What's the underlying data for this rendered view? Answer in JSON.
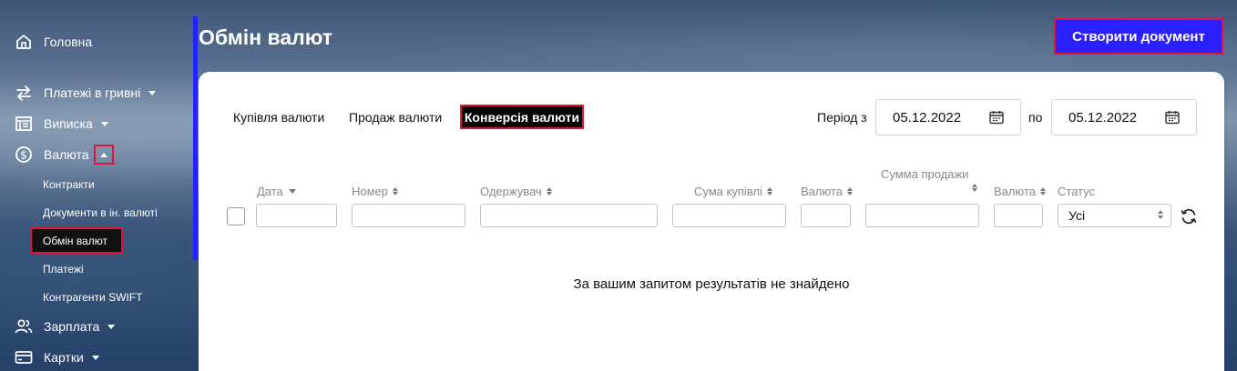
{
  "sidebar": {
    "items": [
      {
        "label": "Головна",
        "icon": "home-icon"
      },
      {
        "label": "Платежі в гривні",
        "icon": "transfer-icon"
      },
      {
        "label": "Виписка",
        "icon": "statement-icon"
      },
      {
        "label": "Валюта",
        "icon": "currency-icon"
      },
      {
        "label": "Зарплата",
        "icon": "users-icon"
      },
      {
        "label": "Картки",
        "icon": "card-icon"
      }
    ],
    "currency_sub": [
      "Контракти",
      "Документи в ін. валюті",
      "Обмін валют",
      "Платежі",
      "Контрагенти SWIFT"
    ]
  },
  "header": {
    "title": "Обмін валют",
    "create_button": "Створити документ"
  },
  "tabs": [
    "Купівля валюти",
    "Продаж валюти",
    "Конверсія валюти"
  ],
  "period": {
    "from_label": "Період з",
    "from": "05.12.2022",
    "to_label": "по",
    "to": "05.12.2022"
  },
  "columns": {
    "date": "Дата",
    "number": "Номер",
    "recipient": "Одержувач",
    "buy_sum": "Сума купівлі",
    "currency1": "Валюта",
    "sell_sum": "Сумма продажи",
    "currency2": "Валюта",
    "status": "Статус"
  },
  "status_filter": {
    "selected": "Усі"
  },
  "empty_message": "За вашим запитом результатів не знайдено",
  "colors": {
    "accent": "#2a1fff",
    "highlight": "#e0143c"
  }
}
